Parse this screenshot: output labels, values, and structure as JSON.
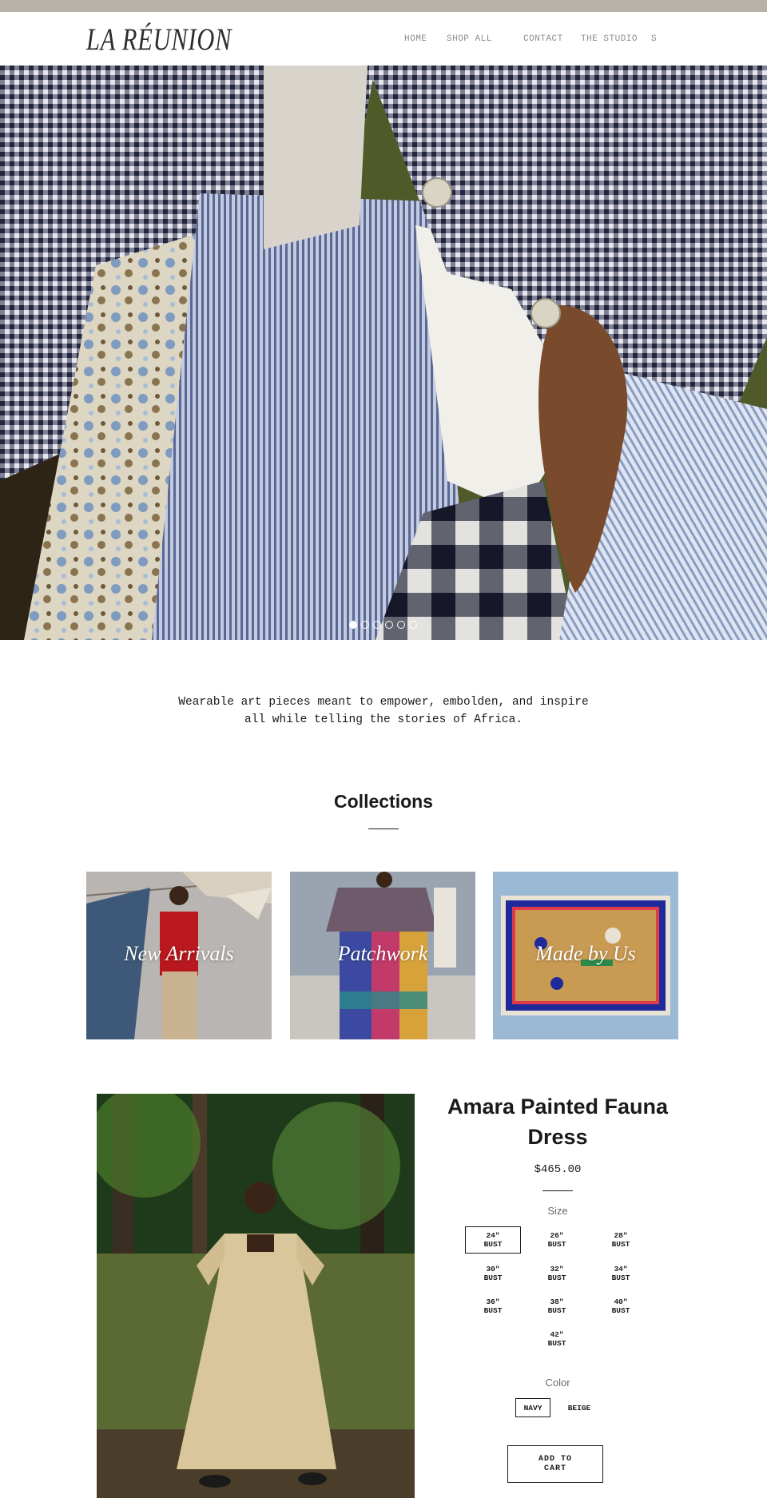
{
  "brand": {
    "logo_text": "LA RÉUNION"
  },
  "nav": {
    "items": [
      {
        "label": "HOME"
      },
      {
        "label": "SHOP ALL"
      },
      {
        "label": "CONTACT"
      },
      {
        "label": "THE STUDIO"
      },
      {
        "label": "S"
      }
    ]
  },
  "hero": {
    "slide_count": 6,
    "active_slide": 1
  },
  "intro": {
    "tagline_line1": "Wearable art pieces meant to empower, embolden, and inspire",
    "tagline_line2": "all while telling the stories of Africa."
  },
  "collections": {
    "title": "Collections",
    "tiles": [
      {
        "label": "New Arrivals"
      },
      {
        "label": "Patchwork"
      },
      {
        "label": "Made by Us"
      }
    ]
  },
  "product": {
    "title": "Amara Painted Fauna Dress",
    "price": "$465.00",
    "size_label": "Size",
    "sizes": [
      {
        "label": "24\"\nBUST",
        "selected": true
      },
      {
        "label": "26\"\nBUST",
        "selected": false
      },
      {
        "label": "28\"\nBUST",
        "selected": false
      },
      {
        "label": "30\"\nBUST",
        "selected": false
      },
      {
        "label": "32\"\nBUST",
        "selected": false
      },
      {
        "label": "34\"\nBUST",
        "selected": false
      },
      {
        "label": "36\"\nBUST",
        "selected": false
      },
      {
        "label": "38\"\nBUST",
        "selected": false
      },
      {
        "label": "40\"\nBUST",
        "selected": false
      },
      {
        "label": "42\"\nBUST",
        "selected": false
      }
    ],
    "color_label": "Color",
    "colors": [
      {
        "label": "NAVY",
        "selected": true
      },
      {
        "label": "BEIGE",
        "selected": false
      }
    ],
    "add_to_cart_label": "ADD TO\nCART"
  },
  "colors": {
    "topbar": "#b8b1a8",
    "text": "#1a1a1a",
    "nav_text": "#8a8a8a"
  }
}
